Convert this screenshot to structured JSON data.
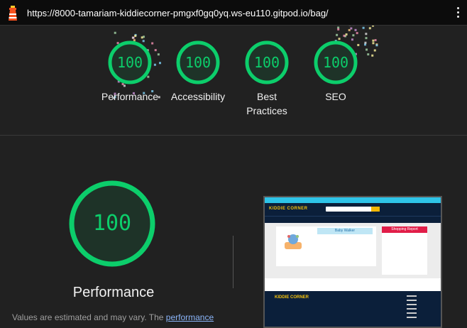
{
  "browser": {
    "url": "https://8000-tamariam-kiddiecorner-pmgxf0gq0yq.ws-eu110.gitpod.io/bag/"
  },
  "summary_scores": [
    {
      "label": "Performance",
      "score": "100"
    },
    {
      "label": "Accessibility",
      "score": "100"
    },
    {
      "label": "Best Practices",
      "score": "100"
    },
    {
      "label": "SEO",
      "score": "100"
    }
  ],
  "performance": {
    "score": "100",
    "title": "Performance",
    "disclaimer_prefix": "Values are estimated and may vary. The ",
    "disclaimer_link": "performance"
  },
  "screenshot_page": {
    "logo": "KIDDIE CORNER",
    "product_title": "Baby Walker",
    "report_title": "Shopping Report",
    "footer_logo": "KIDDIE CORNER"
  },
  "colors": {
    "pass_green": "#0cce6b",
    "background": "#212121",
    "link": "#8ab4f8"
  },
  "icons": {
    "brand": "lighthouse-icon",
    "menu": "kebab-menu-icon"
  }
}
